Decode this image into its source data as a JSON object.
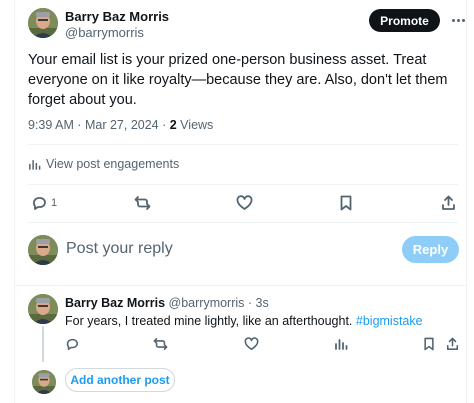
{
  "post": {
    "author_name": "Barry Baz Morris",
    "author_handle": "@barrymorris",
    "promote_label": "Promote",
    "text": "Your email list is your prized one-person business asset. Treat everyone on it like royalty—because they are. Also, don't let them forget about you.",
    "timestamp": "9:39 AM · Mar 27, 2024 · ",
    "views_count": "2",
    "views_label": " Views",
    "engagements_label": "View post engagements",
    "reply_count": "1"
  },
  "composer": {
    "placeholder": "Post your reply",
    "reply_label": "Reply"
  },
  "reply": {
    "author_name": "Barry Baz Morris",
    "author_handle": " @barrymorris · 3s",
    "text": "For years, I treated mine lightly, like an afterthought. ",
    "hashtag": "#bigmistake"
  },
  "add_post_label": "Add another post",
  "icons": {
    "reply": "reply-icon",
    "repost": "repost-icon",
    "like": "heart-icon",
    "bookmark": "bookmark-icon",
    "share": "share-icon",
    "analytics": "analytics-icon",
    "more": "more-icon"
  },
  "colors": {
    "accent": "#1d9bf0",
    "reply_button_disabled": "#8ecdf8",
    "promote_button": "#0f1419",
    "secondary_text": "#536471"
  }
}
